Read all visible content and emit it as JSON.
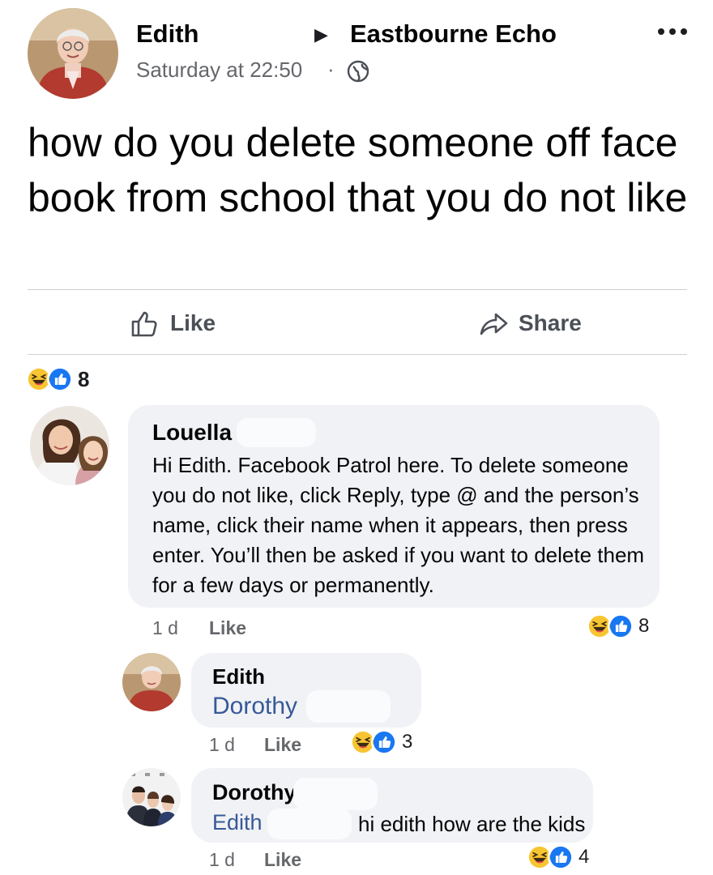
{
  "post": {
    "author": "Edith",
    "group": "Eastbourne Echo",
    "time": "Saturday at 22:50",
    "dot": "·",
    "text": "how do you delete someone off face book from school that you do not like",
    "like_label": "Like",
    "share_label": "Share",
    "reaction_count": "8"
  },
  "comments": [
    {
      "author": "Louella",
      "text": "Hi Edith. Facebook Patrol here. To delete someone you do not like, click Reply, type @ and the person’s name, click their name when it appears, then press enter. You’ll then be asked if you want to delete them for a few days or permanently.",
      "age": "1 d",
      "like_label": "Like",
      "reaction_count": "8"
    },
    {
      "author": "Edith",
      "mention": "Dorothy",
      "age": "1 d",
      "like_label": "Like",
      "reaction_count": "3"
    },
    {
      "author": "Dorothy",
      "mention": "Edith",
      "text": "hi edith how are the kids",
      "age": "1 d",
      "like_label": "Like",
      "reaction_count": "4"
    }
  ],
  "icons": {
    "globe": "globe-icon",
    "more": "more-options-icon",
    "like": "thumbs-up-icon",
    "share": "share-arrow-icon",
    "haha": "haha-reaction-icon",
    "like_reaction": "like-reaction-icon"
  },
  "colors": {
    "link": "#385898",
    "like_blue": "#1877f2",
    "haha_yellow": "#f7c531",
    "bubble_bg": "#f0f2f5",
    "meta_gray": "#65676b"
  }
}
